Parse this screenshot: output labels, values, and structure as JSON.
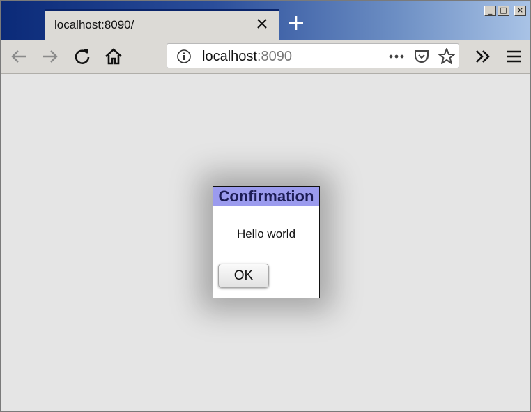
{
  "tab": {
    "title": "localhost:8090/"
  },
  "address_bar": {
    "host": "localhost",
    "port": ":8090"
  },
  "dialog": {
    "title": "Confirmation",
    "message": "Hello world",
    "ok_label": "OK"
  },
  "window_controls": {
    "minimize": "_",
    "maximize": "□",
    "close": "×"
  },
  "colors": {
    "dialog_title_bg": "#9b9bee",
    "dialog_title_text": "#1c1c55",
    "tab_accent": "#0a246a"
  },
  "icons": [
    "close-tab-icon",
    "new-tab-icon",
    "back-icon",
    "forward-icon",
    "reload-icon",
    "home-icon",
    "info-icon",
    "more-icon",
    "pocket-icon",
    "bookmark-star-icon",
    "overflow-icon",
    "menu-icon"
  ]
}
